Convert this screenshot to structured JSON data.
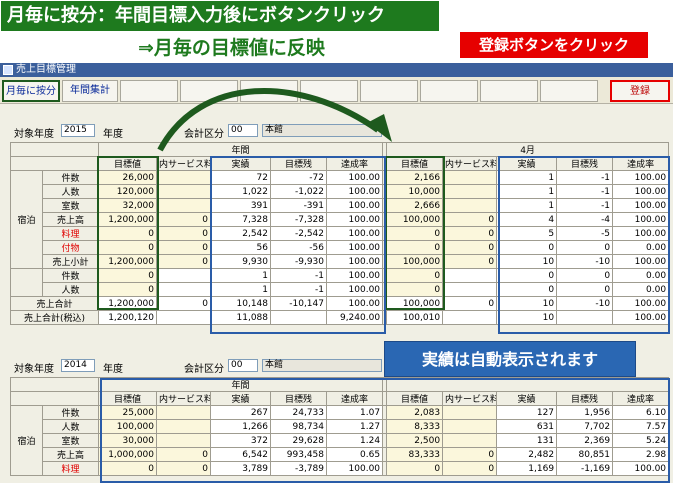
{
  "banner": "月毎に按分：年間目標入力後にボタンクリック",
  "subtitle": "⇒月毎の目標値に反映",
  "callout_register": "登録ボタンをクリック",
  "callout_auto": "実績は自動表示されます",
  "window_title": "売上目標管理",
  "toolbar": {
    "monthly": "月毎に按分",
    "annual": "年間集計",
    "register": "登録"
  },
  "top": {
    "year_label": "対象年度",
    "year": "2015",
    "year_suffix": "年度",
    "dept_label": "会計区分",
    "dept_code": "00",
    "dept_name": "本館",
    "period_annual": "年間",
    "period_month": "4月",
    "col_target": "目標値",
    "col_service": "内サービス料",
    "col_actual": "実績",
    "col_remain": "目標残",
    "col_rate": "達成率",
    "category": "宿泊",
    "rows": [
      {
        "label": "件数",
        "red": false,
        "t": "26,000",
        "s": "",
        "a": "72",
        "r": "-72",
        "p": "100.00",
        "mt": "2,166",
        "ms": "",
        "ma": "1",
        "mr": "-1",
        "mp": "100.00"
      },
      {
        "label": "人数",
        "red": false,
        "t": "120,000",
        "s": "",
        "a": "1,022",
        "r": "-1,022",
        "p": "100.00",
        "mt": "10,000",
        "ms": "",
        "ma": "1",
        "mr": "-1",
        "mp": "100.00"
      },
      {
        "label": "室数",
        "red": false,
        "t": "32,000",
        "s": "",
        "a": "391",
        "r": "-391",
        "p": "100.00",
        "mt": "2,666",
        "ms": "",
        "ma": "1",
        "mr": "-1",
        "mp": "100.00"
      },
      {
        "label": "売上高",
        "red": false,
        "t": "1,200,000",
        "s": "0",
        "a": "7,328",
        "r": "-7,328",
        "p": "100.00",
        "mt": "100,000",
        "ms": "0",
        "ma": "4",
        "mr": "-4",
        "mp": "100.00"
      },
      {
        "label": "料理",
        "red": true,
        "t": "0",
        "s": "0",
        "a": "2,542",
        "r": "-2,542",
        "p": "100.00",
        "mt": "0",
        "ms": "0",
        "ma": "5",
        "mr": "-5",
        "mp": "100.00"
      },
      {
        "label": "付物",
        "red": true,
        "t": "0",
        "s": "0",
        "a": "56",
        "r": "-56",
        "p": "100.00",
        "mt": "0",
        "ms": "0",
        "ma": "0",
        "mr": "0",
        "mp": "0.00"
      },
      {
        "label": "売上小計",
        "red": false,
        "t": "1,200,000",
        "s": "0",
        "a": "9,930",
        "r": "-9,930",
        "p": "100.00",
        "mt": "100,000",
        "ms": "0",
        "ma": "10",
        "mr": "-10",
        "mp": "100.00"
      }
    ],
    "rows2": [
      {
        "label": "件数",
        "t": "0",
        "s": "",
        "a": "1",
        "r": "-1",
        "p": "100.00",
        "mt": "0",
        "ms": "",
        "ma": "0",
        "mr": "0",
        "mp": "0.00"
      },
      {
        "label": "人数",
        "t": "0",
        "s": "",
        "a": "1",
        "r": "-1",
        "p": "100.00",
        "mt": "0",
        "ms": "",
        "ma": "0",
        "mr": "0",
        "mp": "0.00"
      }
    ],
    "totals": [
      {
        "label": "売上合計",
        "t": "1,200,000",
        "s": "0",
        "a": "10,148",
        "r": "-10,147",
        "p": "100.00",
        "mt": "100,000",
        "ms": "0",
        "ma": "10",
        "mr": "-10",
        "mp": "100.00"
      },
      {
        "label": "売上合計(税込)",
        "t": "1,200,120",
        "s": "",
        "a": "11,088",
        "r": "",
        "p": "9,240.00",
        "mt": "100,010",
        "ms": "",
        "ma": "10",
        "mr": "",
        "mp": "100.00"
      }
    ]
  },
  "bottom": {
    "year_label": "対象年度",
    "year": "2014",
    "year_suffix": "年度",
    "dept_label": "会計区分",
    "dept_code": "00",
    "dept_name": "本館",
    "period_annual": "年間",
    "col_target": "目標値",
    "col_service": "内サービス料",
    "col_actual": "実績",
    "col_remain": "目標残",
    "col_rate": "達成率",
    "category": "宿泊",
    "rows": [
      {
        "label": "件数",
        "red": false,
        "t": "25,000",
        "s": "",
        "a": "267",
        "r": "24,733",
        "p": "1.07",
        "mt": "2,083",
        "ms": "",
        "ma": "127",
        "mr": "1,956",
        "mp": "6.10"
      },
      {
        "label": "人数",
        "red": false,
        "t": "100,000",
        "s": "",
        "a": "1,266",
        "r": "98,734",
        "p": "1.27",
        "mt": "8,333",
        "ms": "",
        "ma": "631",
        "mr": "7,702",
        "mp": "7.57"
      },
      {
        "label": "室数",
        "red": false,
        "t": "30,000",
        "s": "",
        "a": "372",
        "r": "29,628",
        "p": "1.24",
        "mt": "2,500",
        "ms": "",
        "ma": "131",
        "mr": "2,369",
        "mp": "5.24"
      },
      {
        "label": "売上高",
        "red": false,
        "t": "1,000,000",
        "s": "0",
        "a": "6,542",
        "r": "993,458",
        "p": "0.65",
        "mt": "83,333",
        "ms": "0",
        "ma": "2,482",
        "mr": "80,851",
        "mp": "2.98"
      },
      {
        "label": "料理",
        "red": true,
        "t": "0",
        "s": "0",
        "a": "3,789",
        "r": "-3,789",
        "p": "100.00",
        "mt": "0",
        "ms": "0",
        "ma": "1,169",
        "mr": "-1,169",
        "mp": "100.00"
      }
    ]
  }
}
